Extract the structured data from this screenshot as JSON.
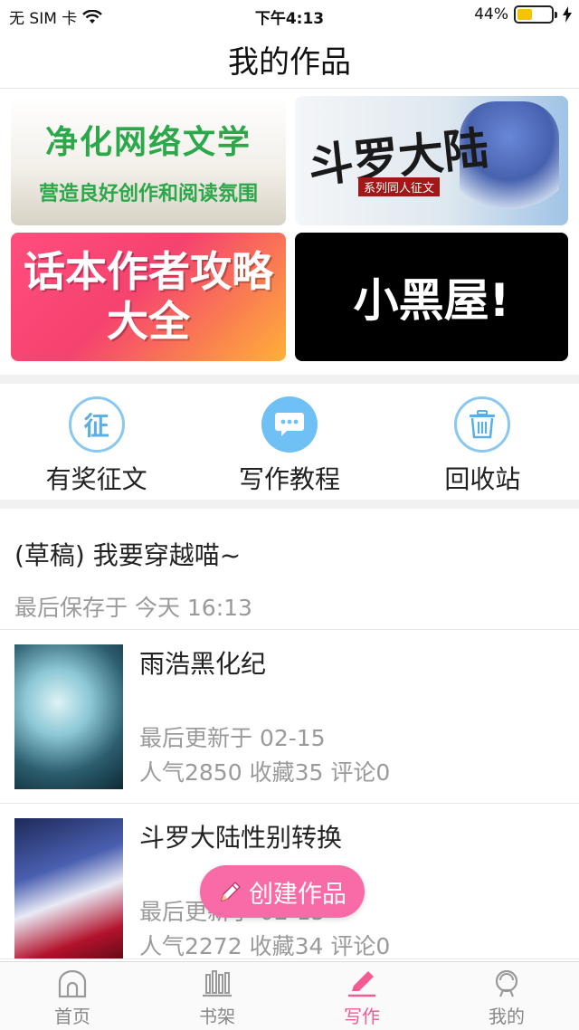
{
  "status_bar": {
    "carrier": "无 SIM 卡",
    "time": "下午4:13",
    "battery_percent": "44%",
    "battery_level": 0.44,
    "battery_color": "#f5c400"
  },
  "nav": {
    "title": "我的作品"
  },
  "banners": {
    "banner1": {
      "line1": "净化网络文学",
      "line2": "营造良好创作和阅读氛围"
    },
    "banner2": {
      "line1": "斗罗大陆",
      "line2": "系列同人征文"
    },
    "banner3": {
      "line1": "话本作者攻略",
      "line2": "大全"
    },
    "banner4": {
      "line1": "小黑屋!"
    }
  },
  "actions": [
    {
      "label": "有奖征文",
      "icon": "contest-icon",
      "glyph": "征"
    },
    {
      "label": "写作教程",
      "icon": "chat-bubble-icon"
    },
    {
      "label": "回收站",
      "icon": "trash-icon"
    }
  ],
  "draft": {
    "title": "(草稿) 我要穿越喵~",
    "saved": "最后保存于 今天 16:13"
  },
  "works": [
    {
      "title": "雨浩黑化纪",
      "updated": "最后更新于 02-15",
      "stats": "人气2850 收藏35 评论0"
    },
    {
      "title": "斗罗大陆性别转换",
      "updated": "最后更新于 02-15",
      "stats": "人气2272 收藏34 评论0"
    }
  ],
  "create_button": {
    "label": "创建作品",
    "color": "#f86ba6"
  },
  "tabs": [
    {
      "label": "首页",
      "icon": "home-icon",
      "active": false
    },
    {
      "label": "书架",
      "icon": "bookshelf-icon",
      "active": false
    },
    {
      "label": "写作",
      "icon": "pencil-icon",
      "active": true
    },
    {
      "label": "我的",
      "icon": "profile-icon",
      "active": false
    }
  ],
  "accent_color": "#f45b93"
}
